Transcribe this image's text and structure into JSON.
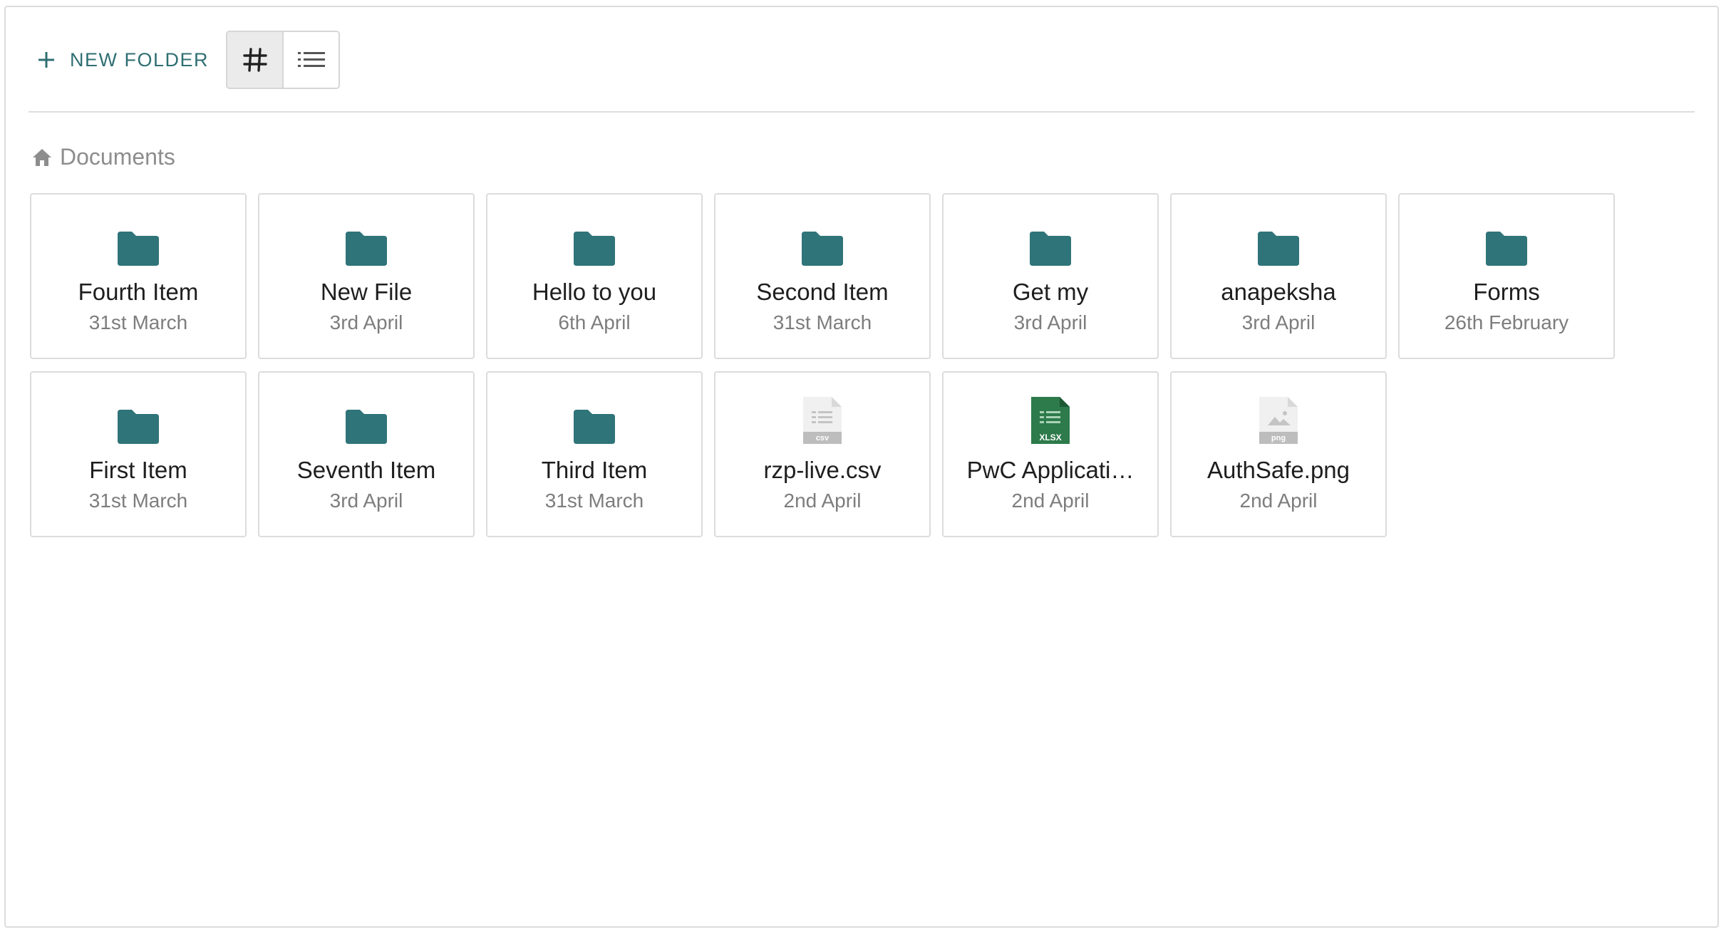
{
  "toolbar": {
    "new_folder_label": "New folder",
    "grid_view_icon": "grid-view-icon",
    "list_view_icon": "list-view-icon",
    "active_view": "grid"
  },
  "breadcrumb": {
    "icon": "home-icon",
    "label": "Documents"
  },
  "colors": {
    "accent": "#2f6f73",
    "folder": "#2f7479",
    "xlsx": "#2d7a4b",
    "file_gray": "#bdbdbd"
  },
  "items": [
    {
      "type": "folder",
      "name": "Fourth Item",
      "date": "31st March"
    },
    {
      "type": "folder",
      "name": "New File",
      "date": "3rd April"
    },
    {
      "type": "folder",
      "name": "Hello to you",
      "date": "6th April"
    },
    {
      "type": "folder",
      "name": "Second Item",
      "date": "31st March"
    },
    {
      "type": "folder",
      "name": "Get my",
      "date": "3rd April"
    },
    {
      "type": "folder",
      "name": "anapeksha",
      "date": "3rd April"
    },
    {
      "type": "folder",
      "name": "Forms",
      "date": "26th February"
    },
    {
      "type": "folder",
      "name": "First Item",
      "date": "31st March"
    },
    {
      "type": "folder",
      "name": "Seventh Item",
      "date": "3rd April"
    },
    {
      "type": "folder",
      "name": "Third Item",
      "date": "31st March"
    },
    {
      "type": "csv",
      "name": "rzp-live.csv",
      "date": "2nd April",
      "badge": "csv"
    },
    {
      "type": "xlsx",
      "name": "PwC Applicati…",
      "date": "2nd April",
      "badge": "XLSX"
    },
    {
      "type": "png",
      "name": "AuthSafe.png",
      "date": "2nd April",
      "badge": "png"
    }
  ]
}
